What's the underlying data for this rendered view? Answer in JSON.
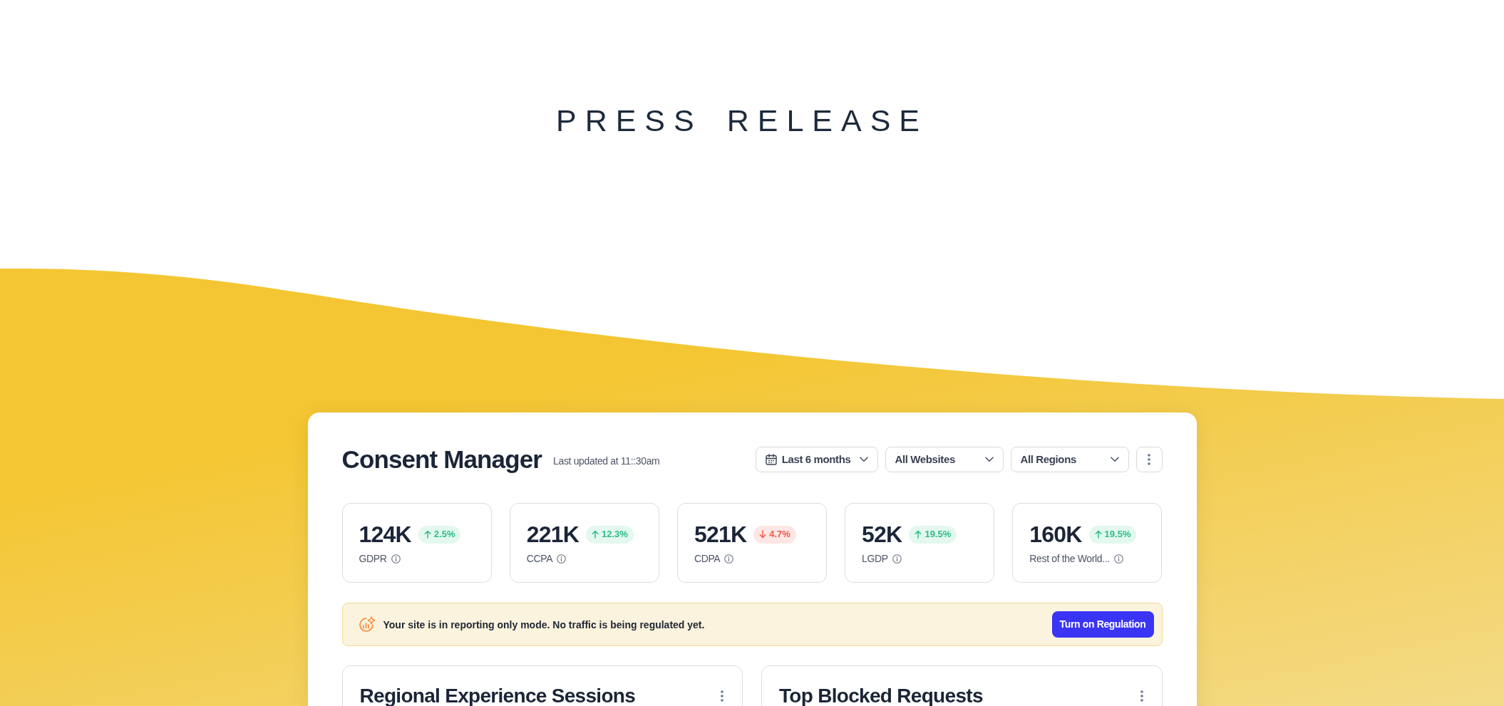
{
  "hero": {
    "title": "PRESS RELEASE"
  },
  "dashboard": {
    "title": "Consent Manager",
    "last_updated": "Last updated at 11::30am",
    "filters": [
      {
        "kind": "date",
        "label": "Last 6 months"
      },
      {
        "kind": "select",
        "label": "All Websites"
      },
      {
        "kind": "select",
        "label": "All Regions"
      }
    ],
    "stats": [
      {
        "value": "124K",
        "kind": "rise",
        "change": "2.5%",
        "label": "GDPR"
      },
      {
        "value": "221K",
        "kind": "rise",
        "change": "12.3%",
        "label": "CCPA"
      },
      {
        "value": "521K",
        "kind": "fall",
        "change": "4.7%",
        "label": "CDPA"
      },
      {
        "value": "52K",
        "kind": "rise",
        "change": "19.5%",
        "label": "LGDP"
      },
      {
        "value": "160K",
        "kind": "rise",
        "change": "19.5%",
        "label": "Rest of the World..."
      }
    ],
    "notice": {
      "text": "Your site is in reporting only mode. No traffic is being regulated yet.",
      "button": "Turn on Regulation"
    },
    "panels": [
      {
        "title": "Regional Experience Sessions"
      },
      {
        "title": "Top Blocked Requests"
      }
    ]
  }
}
